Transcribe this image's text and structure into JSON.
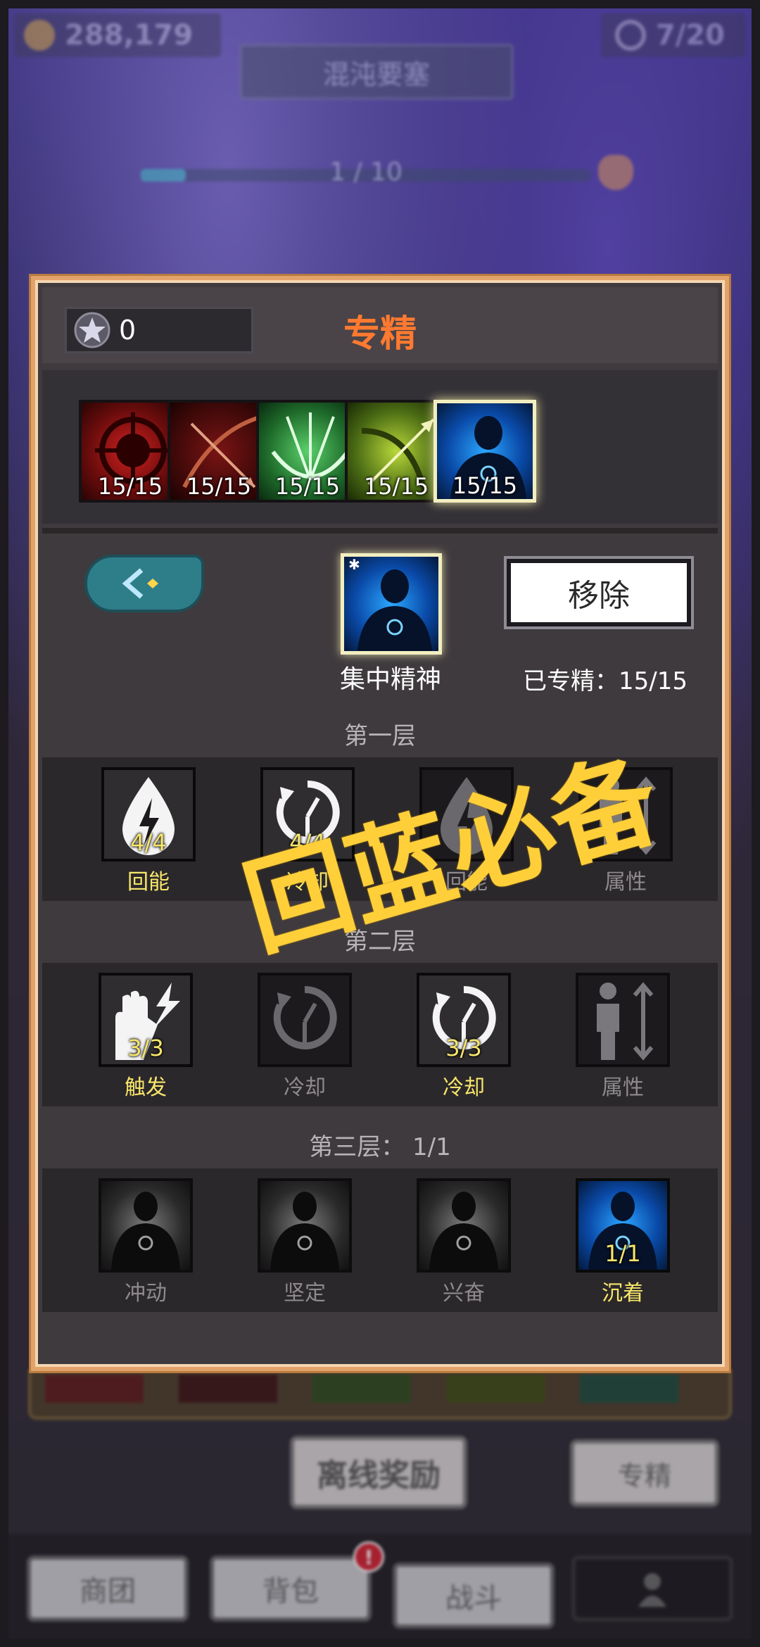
{
  "hud": {
    "gold": "288,179",
    "keys": "7/20",
    "stage_name": "混沌要塞",
    "progress_text": "1 / 10",
    "progress_fraction": 0.1
  },
  "panel": {
    "title": "专精",
    "points": "0",
    "trees": [
      {
        "count": "15/15",
        "icon": "red-target-icon"
      },
      {
        "count": "15/15",
        "icon": "red-crossbow-icon"
      },
      {
        "count": "15/15",
        "icon": "green-multishot-bow-icon"
      },
      {
        "count": "15/15",
        "icon": "yellow-bow-icon"
      },
      {
        "count": "15/15",
        "icon": "blue-focus-figure-icon",
        "selected": true
      }
    ],
    "selected_spec": {
      "name": "集中精神",
      "remove_label": "移除",
      "progress_label": "已专精：15/15"
    },
    "tiers": [
      {
        "label": "第一层",
        "skills": [
          {
            "name": "回能",
            "count": "4/4",
            "icon": "energy-drop-icon",
            "active": true
          },
          {
            "name": "冷却",
            "count": "4/4",
            "icon": "cooldown-clock-icon",
            "active": true
          },
          {
            "name": "回能",
            "count": "",
            "icon": "energy-drop-icon",
            "active": false
          },
          {
            "name": "属性",
            "count": "",
            "icon": "attribute-figure-icon",
            "active": false
          }
        ]
      },
      {
        "label": "第二层",
        "skills": [
          {
            "name": "触发",
            "count": "3/3",
            "icon": "lightning-hand-icon",
            "active": true
          },
          {
            "name": "冷却",
            "count": "",
            "icon": "cooldown-clock-icon",
            "active": false
          },
          {
            "name": "冷却",
            "count": "3/3",
            "icon": "cooldown-clock-icon",
            "active": true
          },
          {
            "name": "属性",
            "count": "",
            "icon": "attribute-figure-icon",
            "active": false
          }
        ]
      },
      {
        "label": "第三层：  1/1",
        "skills": [
          {
            "name": "冲动",
            "count": "",
            "icon": "gray-figure-icon",
            "active": false
          },
          {
            "name": "坚定",
            "count": "",
            "icon": "gray-figure-icon",
            "active": false
          },
          {
            "name": "兴奋",
            "count": "",
            "icon": "gray-figure-icon",
            "active": false
          },
          {
            "name": "沉着",
            "count": "1/1",
            "icon": "blue-focus-figure-icon",
            "active": true
          }
        ]
      }
    ]
  },
  "overlay_caption": "回蓝必备",
  "bottom": {
    "offline_reward": "离线奖励",
    "spec_button": "专精",
    "nav": [
      "商团",
      "背包",
      "战斗",
      ""
    ],
    "badge": "!"
  },
  "colors": {
    "title_orange": "#ff7a30",
    "active_yellow": "#f7e66a",
    "panel_border": "#e2a36a",
    "overlay_yellow": "#ffcf3a"
  }
}
